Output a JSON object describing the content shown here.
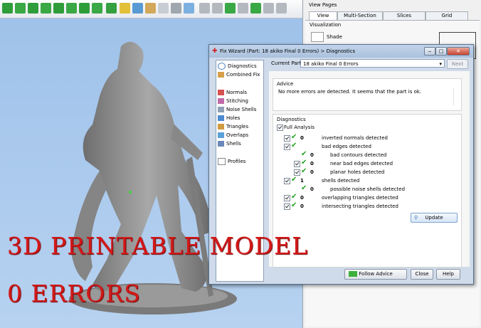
{
  "right_panel": {
    "title": "View Pages",
    "tabs": [
      "View",
      "Multi-Section",
      "Slices",
      "Grid"
    ],
    "section": "Visualization",
    "shade_label": "Shade"
  },
  "dialog": {
    "title": "Fix Wizard (Part: 18 akiko Final 0 Errors) > Diagnostics",
    "nav": [
      "Diagnostics",
      "Combined Fix",
      "Normals",
      "Stitching",
      "Noise Shells",
      "Holes",
      "Triangles",
      "Overlaps",
      "Shells",
      "Profiles"
    ],
    "current_part_label": "Current Part:",
    "current_part_value": "18 akiko Final 0 Errors",
    "next_label": "Next",
    "advice_label": "Advice",
    "advice_text": "No more errors are detected. It seems that the part is ok.",
    "diagnostics_label": "Diagnostics",
    "full_analysis": "Full Analysis",
    "rows": [
      {
        "count": "0",
        "label": "inverted normals detected"
      },
      {
        "count": "",
        "label": "bad edges detected"
      },
      {
        "count": "0",
        "label": "bad contours detected"
      },
      {
        "count": "0",
        "label": "near bad edges detected"
      },
      {
        "count": "0",
        "label": "planar holes detected"
      },
      {
        "count": "1",
        "label": "shells detected"
      },
      {
        "count": "0",
        "label": "possible noise shells detected"
      },
      {
        "count": "0",
        "label": "overlapping triangles detected"
      },
      {
        "count": "0",
        "label": "intersecting triangles detected"
      }
    ],
    "update_label": "Update",
    "follow_advice_label": "Follow Advice",
    "close_label": "Close",
    "help_label": "Help"
  },
  "overlay": {
    "line1": "3D PRINTABLE MODEL",
    "line2": "0 ERRORS"
  },
  "colors": {
    "overlay_text": "#d41818",
    "check": "#22a322",
    "viewport": "#a9c6e8"
  }
}
